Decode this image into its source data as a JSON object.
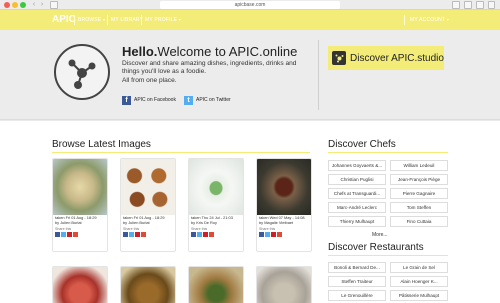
{
  "browser": {
    "url": "apicbase.com"
  },
  "nav": {
    "logo": "APIC",
    "browse": "BROWSE",
    "library": "MY LIBRARY",
    "profile": "MY PROFILE",
    "account": "MY ACCOUNT"
  },
  "hero": {
    "hello": "Hello.",
    "welcome": "Welcome to APIC.online",
    "text": "Discover and share amazing dishes, ingredients, drinks and things you'll love as a foodie.",
    "text2": "All from one place.",
    "facebook": "APIC on Facebook",
    "twitter": "APIC on Twitter",
    "discover_button": "Discover APIC.studio"
  },
  "colors": {
    "accent": "#f3ec78",
    "facebook": "#3b5998",
    "twitter": "#55acee"
  },
  "latest": {
    "title": "Browse Latest Images",
    "share_label": "Share this",
    "cards": [
      {
        "line1": "taken Fri 01 Aug - 18:29",
        "line2": "by Julien Burlat"
      },
      {
        "line1": "taken Fri 01 Aug - 18:29",
        "line2": "by Julien Burlat"
      },
      {
        "line1": "taken Thu 24 Jul - 21:03",
        "line2": "by Kris De Roy"
      },
      {
        "line1": "taken Wed 07 May - 14:08",
        "line2": "by Magalie Vietbaet"
      }
    ]
  },
  "chefs": {
    "title": "Discover Chefs",
    "items": [
      "Johannes Goyvaerts &...",
      "William Ledeuil",
      "Christian Puglisi",
      "Jean-François Piège",
      "Chefs at Transguardi...",
      "Pierre Gagnaire",
      "Marc-André Leclerc",
      "Tom Steffen",
      "Thierry Mulhaupt",
      "Fino Cuttaia"
    ],
    "more": "More..."
  },
  "restaurants": {
    "title": "Discover Restaurants",
    "items": [
      "Bonoli & Bernard De...",
      "Le Grain de Sel",
      "Steffen Traiteur",
      "Alain Hoenger K...",
      "Le Grenouillère",
      "Pâtisserie Mulhaupt"
    ]
  }
}
